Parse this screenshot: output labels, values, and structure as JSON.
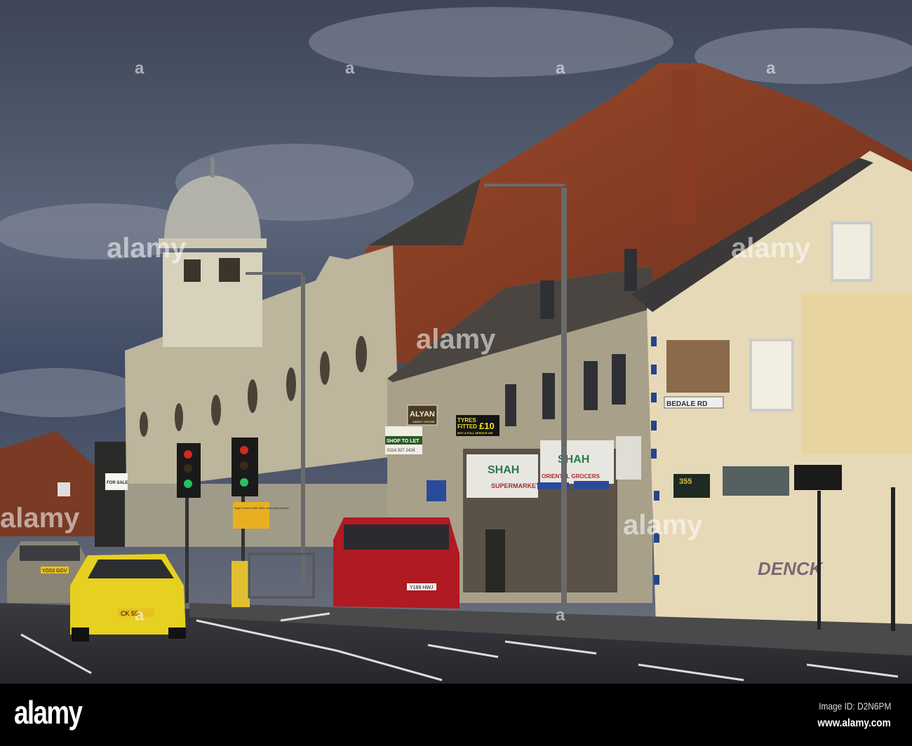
{
  "photo": {
    "watermark_text": "alamy",
    "watermark_letter": "a",
    "signs": {
      "alyan": "ALYAN",
      "alyan_sub": "SWEET CENTRE",
      "shop_to_let": "SHOP TO LET",
      "shop_to_let_phone": "0114 327 2426",
      "tyres_line1": "TYRES",
      "tyres_line2": "FITTED",
      "tyres_price": "£10",
      "tyres_line3": "MOT & FULL SERVICE £50",
      "shah": "SHAH",
      "supermarket": "SUPERMARKET",
      "oriental_grocers": "ORIENTAL GROCERS",
      "for_sale": "FOR SALE",
      "street_name": "BEDALE RD",
      "one_way": "Right Turners ONE WAY oncoming vehicles",
      "shop_sign_small": "355",
      "graffiti": "DENCK",
      "plate_yellow": "CK 59",
      "plate_van": "Y189 HWJ",
      "plate_silver": "YG53 GGV"
    }
  },
  "footer": {
    "logo": "alamy",
    "image_id": "Image ID: D2N6PM",
    "url": "www.alamy.com"
  }
}
